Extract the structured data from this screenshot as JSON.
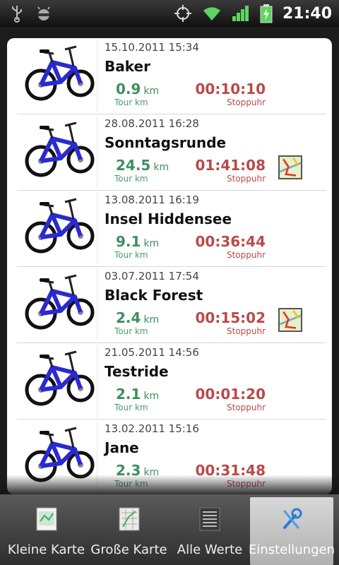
{
  "status_bar": {
    "time": "21:40",
    "icons": [
      "usb-icon",
      "android-debug-icon",
      "gps-icon",
      "wifi-icon",
      "signal-icon",
      "battery-charging-icon"
    ]
  },
  "tours": [
    {
      "date": "15.10.2011 15:34",
      "name": "Baker",
      "distance": "0.9",
      "distance_unit": "km",
      "distance_label": "Tour km",
      "time": "00:10:10",
      "time_label": "Stoppuhr",
      "has_map": false
    },
    {
      "date": "28.08.2011 16:28",
      "name": "Sonntagsrunde",
      "distance": "24.5",
      "distance_unit": "km",
      "distance_label": "Tour km",
      "time": "01:41:08",
      "time_label": "Stoppuhr",
      "has_map": true
    },
    {
      "date": "13.08.2011 16:19",
      "name": "Insel Hiddensee",
      "distance": "9.1",
      "distance_unit": "km",
      "distance_label": "Tour km",
      "time": "00:36:44",
      "time_label": "Stoppuhr",
      "has_map": false
    },
    {
      "date": "03.07.2011 17:54",
      "name": "Black Forest",
      "distance": "2.4",
      "distance_unit": "km",
      "distance_label": "Tour km",
      "time": "00:15:02",
      "time_label": "Stoppuhr",
      "has_map": true
    },
    {
      "date": "21.05.2011 14:56",
      "name": "Testride",
      "distance": "2.1",
      "distance_unit": "km",
      "distance_label": "Tour km",
      "time": "00:01:20",
      "time_label": "Stoppuhr",
      "has_map": false
    },
    {
      "date": "13.02.2011 15:16",
      "name": "Jane",
      "distance": "2.3",
      "distance_unit": "km",
      "distance_label": "Tour km",
      "time": "00:31:48",
      "time_label": "Stoppuhr",
      "has_map": false
    }
  ],
  "tabs": [
    {
      "label": "Kleine Karte",
      "icon": "small-map-icon",
      "active": false
    },
    {
      "label": "Große Karte",
      "icon": "large-map-icon",
      "active": false
    },
    {
      "label": "Alle Werte",
      "icon": "all-values-icon",
      "active": false
    },
    {
      "label": "Einstellungen",
      "icon": "settings-wrench-icon",
      "active": true
    }
  ],
  "colors": {
    "distance_green": "#3f8f5f",
    "time_red": "#b84a4a",
    "bike_blue": "#2a2ad0"
  }
}
